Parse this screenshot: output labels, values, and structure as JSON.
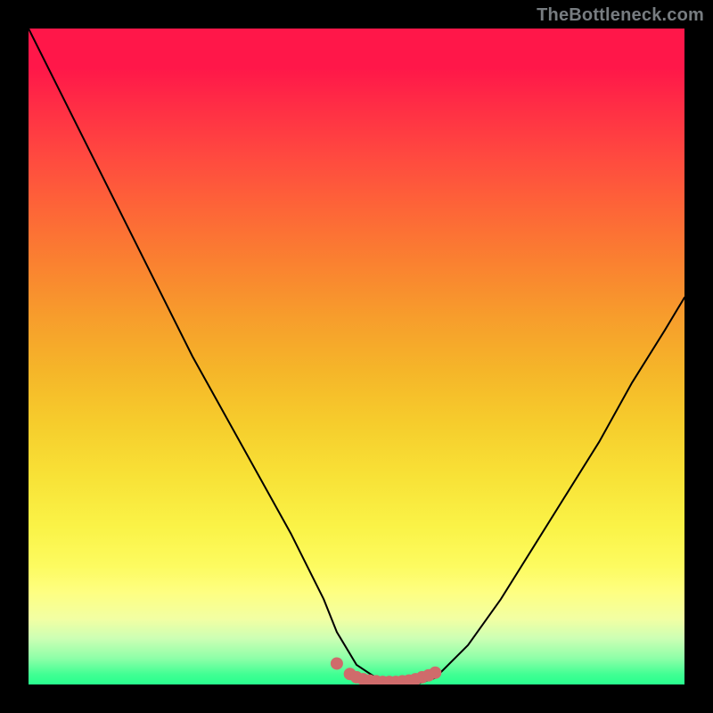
{
  "watermark": "TheBottleneck.com",
  "chart_data": {
    "type": "line",
    "title": "",
    "xlabel": "",
    "ylabel": "",
    "xlim": [
      0,
      100
    ],
    "ylim": [
      0,
      100
    ],
    "grid": false,
    "legend": false,
    "series": [
      {
        "name": "bottleneck-curve",
        "x": [
          0,
          5,
          10,
          15,
          20,
          25,
          30,
          35,
          40,
          45,
          47,
          50,
          53,
          55,
          57,
          59,
          62,
          67,
          72,
          77,
          82,
          87,
          92,
          97,
          100
        ],
        "y": [
          100,
          90,
          80,
          70,
          60,
          50,
          41,
          32,
          23,
          13,
          8,
          3,
          1,
          0,
          0,
          0,
          1,
          6,
          13,
          21,
          29,
          37,
          46,
          54,
          59
        ],
        "color": "#000000"
      },
      {
        "name": "bottom-highlight-dots",
        "x": [
          47,
          49,
          50,
          51,
          52,
          53,
          54,
          55,
          56,
          57,
          58,
          59,
          60,
          61,
          62
        ],
        "y": [
          3.2,
          1.6,
          1.1,
          0.8,
          0.6,
          0.5,
          0.4,
          0.4,
          0.4,
          0.5,
          0.6,
          0.8,
          1.1,
          1.4,
          1.8
        ],
        "color": "#cf6b6b"
      }
    ],
    "colors": {
      "background_frame": "#000000",
      "curve": "#000000",
      "highlight": "#cf6b6b",
      "gradient_top": "#ff1749",
      "gradient_bottom": "#28ff8e",
      "watermark": "#777c80"
    }
  }
}
